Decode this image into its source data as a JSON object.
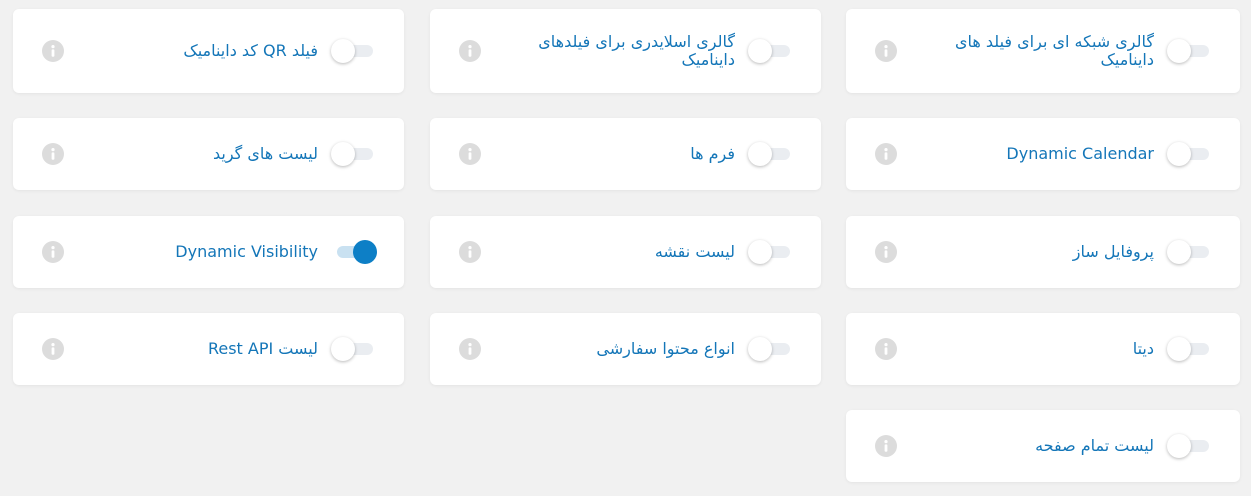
{
  "colors": {
    "accent": "#0d7fc6",
    "label": "#1476b8",
    "info_icon": "#dcdcdc",
    "background": "#f1f1f1",
    "card": "#ffffff"
  },
  "modules": [
    {
      "label": "گالری شبکه ای برای فیلد های داینامیک",
      "enabled": false
    },
    {
      "label": "گالری اسلایدری برای فیلدهای داینامیک",
      "enabled": false
    },
    {
      "label": "فیلد QR کد داینامیک",
      "enabled": false
    },
    {
      "label": "Dynamic Calendar",
      "enabled": false
    },
    {
      "label": "فرم ها",
      "enabled": false
    },
    {
      "label": "لیست های گرید",
      "enabled": false
    },
    {
      "label": "پروفایل ساز",
      "enabled": false
    },
    {
      "label": "لیست نقشه",
      "enabled": false
    },
    {
      "label": "Dynamic Visibility",
      "enabled": true
    },
    {
      "label": "دیتا",
      "enabled": false
    },
    {
      "label": "انواع محتوا سفارشی",
      "enabled": false
    },
    {
      "label": "لیست Rest API",
      "enabled": false
    },
    {
      "label": "لیست تمام صفحه",
      "enabled": false
    }
  ]
}
